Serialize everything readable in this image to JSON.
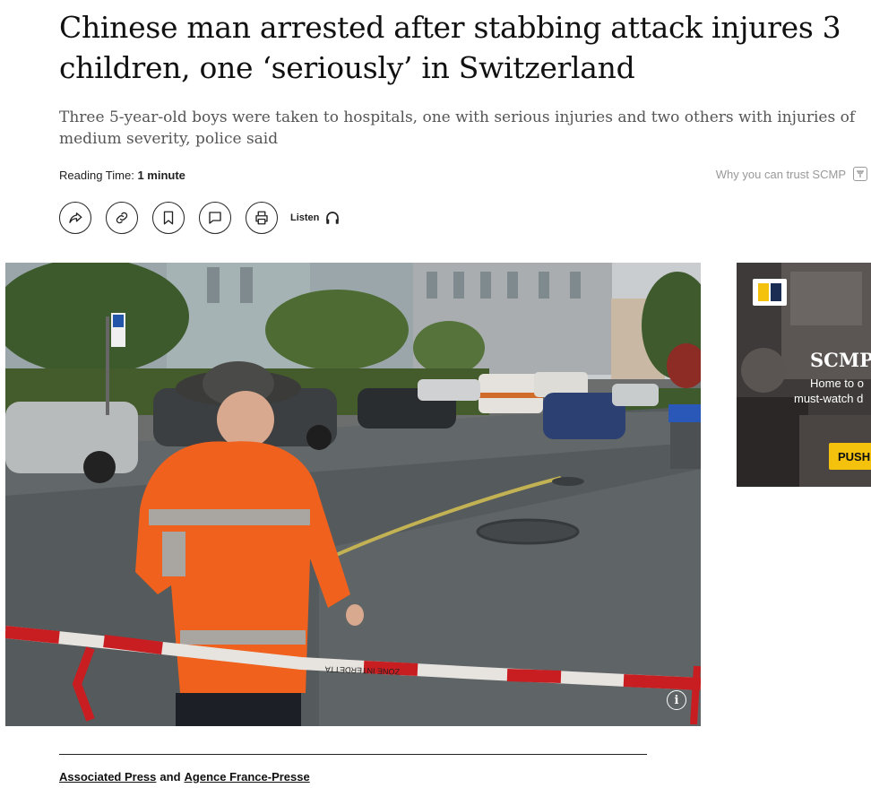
{
  "article": {
    "headline": "Chinese man arrested after stabbing attack injures 3 children, one ‘seriously’ in Switzerland",
    "subhead": "Three 5-year-old boys were taken to hospitals, one with serious injuries and two others with injuries of medium severity, police said",
    "reading_time_label": "Reading Time:",
    "reading_time_value": "1 minute",
    "trust_text": "Why you can trust SCMP"
  },
  "actions": {
    "listen_label": "Listen",
    "icons": [
      "share-icon",
      "link-icon",
      "bookmark-icon",
      "comment-icon",
      "print-icon",
      "headphones-icon"
    ]
  },
  "photo": {
    "info_label": "i",
    "tape_text": "ZONE INTERDETTA"
  },
  "ad": {
    "brand": "SCMP",
    "line1": "Home to o",
    "line2": "must-watch d",
    "cta": "PUSH",
    "colors": {
      "yellow": "#f4c20d",
      "navy": "#1b2d52"
    }
  },
  "byline": {
    "author1": "Associated Press",
    "conjunction": "and",
    "author2": "Agence France-Presse"
  }
}
